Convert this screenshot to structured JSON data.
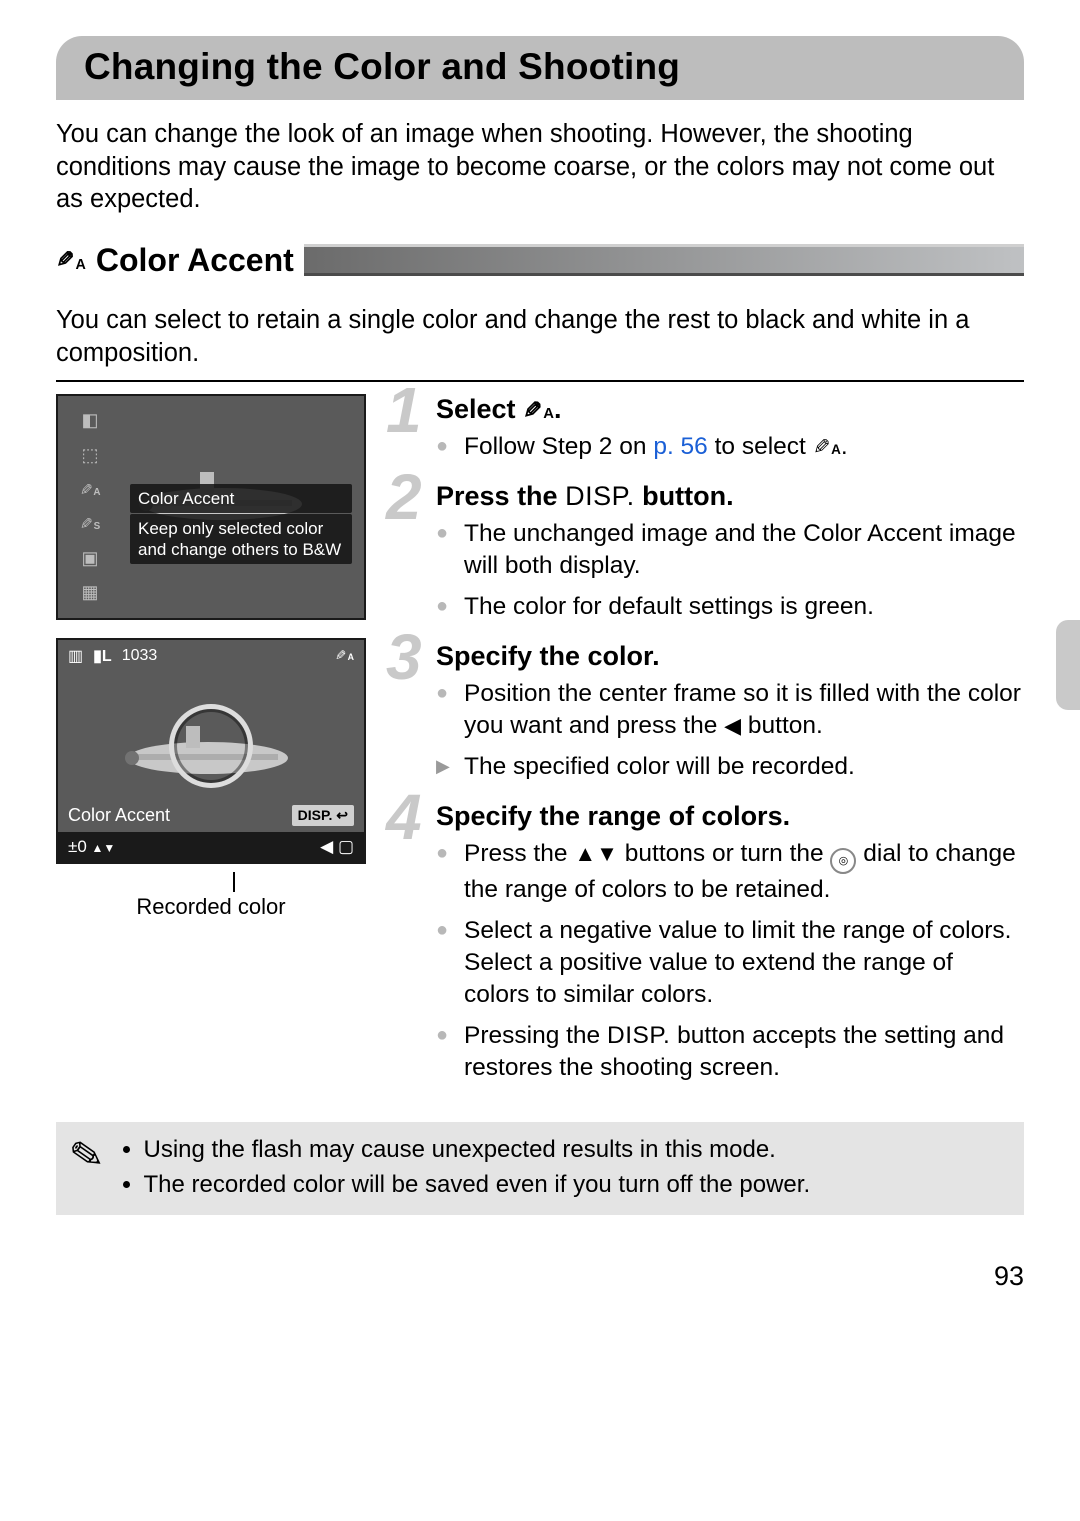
{
  "title": "Changing the Color and Shooting",
  "intro": "You can change the look of an image when shooting. However, the shooting conditions may cause the image to become coarse, or the colors may not come out as expected.",
  "section": {
    "icon_label": "A",
    "heading": "Color Accent",
    "desc": "You can select to retain a single color and change the rest to black and white in a composition."
  },
  "shot1": {
    "mode_label": "Color Accent",
    "hint_l1": "Keep only selected color",
    "hint_l2": "and change others to B&W"
  },
  "shot2": {
    "top_number": "1033",
    "mode_label": "Color Accent",
    "range_label": "±0",
    "disp": "DISP.",
    "caption": "Recorded color"
  },
  "steps": [
    {
      "num": "1",
      "title_pre": "Select ",
      "title_icon_sub": "A",
      "title_post": ".",
      "items": [
        {
          "kind": "bullet",
          "pre": "Follow Step 2 on ",
          "link": "p. 56",
          "mid": " to select ",
          "icon_sub": "A",
          "post": "."
        }
      ]
    },
    {
      "num": "2",
      "title_pre": "Press the ",
      "title_disp": "DISP.",
      "title_post": " button.",
      "items": [
        {
          "kind": "bullet",
          "text": "The unchanged image and the Color Accent image will both display."
        },
        {
          "kind": "bullet",
          "text": "The color for default settings is green."
        }
      ]
    },
    {
      "num": "3",
      "title": "Specify the color.",
      "items": [
        {
          "kind": "bullet",
          "pre": "Position the center frame so it is filled with the color you want and press the ",
          "sym": "◀",
          "post": " button."
        },
        {
          "kind": "arrow",
          "text": "The specified color will be recorded."
        }
      ]
    },
    {
      "num": "4",
      "title": "Specify the range of colors.",
      "items": [
        {
          "kind": "bullet",
          "pre": "Press the ",
          "sym": "▲▼",
          "mid": " buttons or turn the ",
          "dial": "◎",
          "post": " dial to change the range of colors to be retained."
        },
        {
          "kind": "bullet",
          "text": "Select a negative value to limit the range of colors. Select a positive value to extend the range of colors to similar colors."
        },
        {
          "kind": "bullet",
          "pre": "Pressing the ",
          "disp": "DISP.",
          "post": " button accepts the setting and restores the shooting screen."
        }
      ]
    }
  ],
  "notes": [
    "Using the flash may cause unexpected results in this mode.",
    "The recorded color will be saved even if you turn off the power."
  ],
  "page_number": "93"
}
